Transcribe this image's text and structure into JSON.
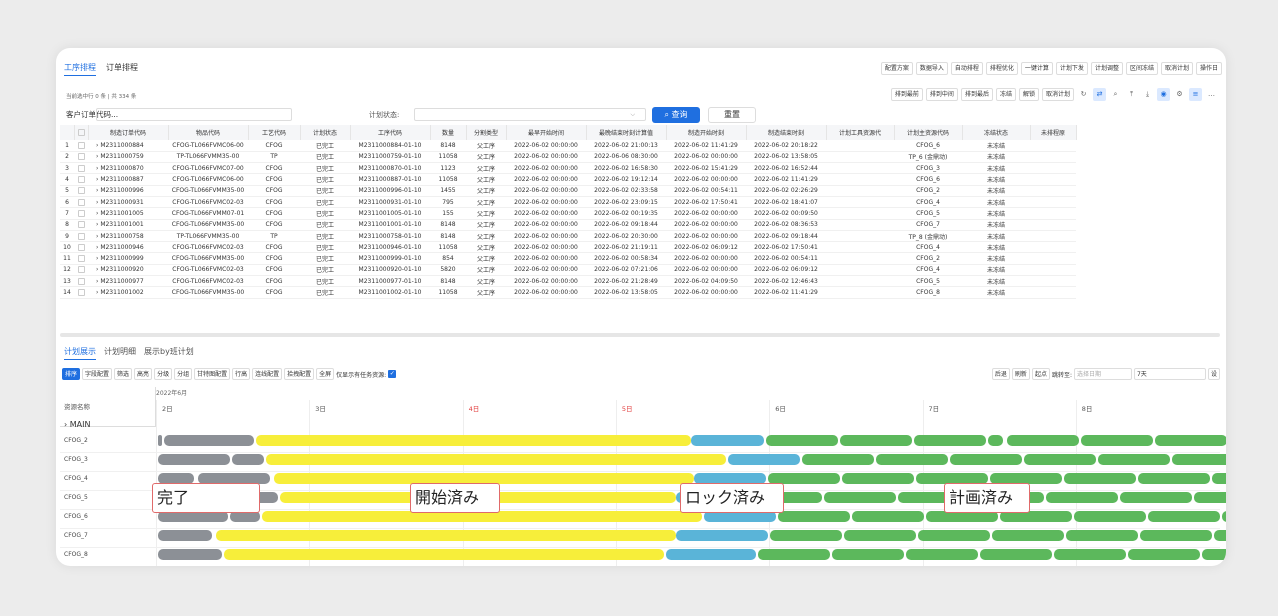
{
  "topTabs": [
    "工序排程",
    "订单排程"
  ],
  "toolbar1": [
    "配置方案",
    "数据导入",
    "自动排程",
    "排程优化",
    "一键计算",
    "计划下发",
    "计划调整",
    "区间冻结",
    "取消计划",
    "操作日"
  ],
  "toolbar2": [
    "排到最前",
    "排到中间",
    "排到最后",
    "冻结",
    "解锁",
    "取消计划"
  ],
  "selInfo": "当前选中行 0 条 | 共 334 条",
  "filter": {
    "customer_placeholder": "客户订单代码...",
    "status_label": "计划状态:",
    "query": "查询",
    "reset": "重置"
  },
  "columns": [
    "",
    "",
    "制造订单代码",
    "物品代码",
    "工艺代码",
    "计划状态",
    "工序代码",
    "数量",
    "分割类型",
    "最早开始时间",
    "最晚结束时刻计算值",
    "制造开始时刻",
    "制造结束时刻",
    "计划工具资源代",
    "计划主资源代码",
    "冻结状态",
    "未排程原"
  ],
  "rows": [
    [
      "1",
      "M2311000884",
      "CFOG-TL066FVMC06-00",
      "CFOG",
      "已完工",
      "M2311000884-01-10",
      "8148",
      "父工序",
      "2022-06-02 00:00:00",
      "2022-06-02 21:00:13",
      "2022-06-02 11:41:29",
      "2022-06-02 20:18:22",
      "",
      "CFOG_6",
      "未冻结"
    ],
    [
      "2",
      "M2311000759",
      "TP-TL066FVMM35-00",
      "TP",
      "已完工",
      "M2311000759-01-10",
      "11058",
      "父工序",
      "2022-06-02 00:00:00",
      "2022-06-06 08:30:00",
      "2022-06-02 00:00:00",
      "2022-06-02 13:58:05",
      "",
      "TP_6 (金鼎动)",
      "未冻结"
    ],
    [
      "3",
      "M2311000870",
      "CFOG-TL066FVMC07-00",
      "CFOG",
      "已完工",
      "M2311000870-01-10",
      "1123",
      "父工序",
      "2022-06-02 00:00:00",
      "2022-06-02 16:58:30",
      "2022-06-02 15:41:29",
      "2022-06-02 16:52:44",
      "",
      "CFOG_3",
      "未冻结"
    ],
    [
      "4",
      "M2311000887",
      "CFOG-TL066FVMC06-00",
      "CFOG",
      "已完工",
      "M2311000887-01-10",
      "11058",
      "父工序",
      "2022-06-02 00:00:00",
      "2022-06-02 19:12:14",
      "2022-06-02 00:00:00",
      "2022-06-02 11:41:29",
      "",
      "CFOG_6",
      "未冻结"
    ],
    [
      "5",
      "M2311000996",
      "CFOG-TL066FVMM35-00",
      "CFOG",
      "已完工",
      "M2311000996-01-10",
      "1455",
      "父工序",
      "2022-06-02 00:00:00",
      "2022-06-02 02:33:58",
      "2022-06-02 00:54:11",
      "2022-06-02 02:26:29",
      "",
      "CFOG_2",
      "未冻结"
    ],
    [
      "6",
      "M2311000931",
      "CFOG-TL066FVMC02-03",
      "CFOG",
      "已完工",
      "M2311000931-01-10",
      "795",
      "父工序",
      "2022-06-02 00:00:00",
      "2022-06-02 23:09:15",
      "2022-06-02 17:50:41",
      "2022-06-02 18:41:07",
      "",
      "CFOG_4",
      "未冻结"
    ],
    [
      "7",
      "M2311001005",
      "CFOG-TL066FVMM07-01",
      "CFOG",
      "已完工",
      "M2311001005-01-10",
      "155",
      "父工序",
      "2022-06-02 00:00:00",
      "2022-06-02 00:19:35",
      "2022-06-02 00:00:00",
      "2022-06-02 00:09:50",
      "",
      "CFOG_5",
      "未冻结"
    ],
    [
      "8",
      "M2311001001",
      "CFOG-TL066FVMM35-00",
      "CFOG",
      "已完工",
      "M2311001001-01-10",
      "8148",
      "父工序",
      "2022-06-02 00:00:00",
      "2022-06-02 09:18:44",
      "2022-06-02 00:00:00",
      "2022-06-02 08:36:53",
      "",
      "CFOG_7",
      "未冻结"
    ],
    [
      "9",
      "M2311000758",
      "TP-TL066FVMM35-00",
      "TP",
      "已完工",
      "M2311000758-01-10",
      "8148",
      "父工序",
      "2022-06-02 00:00:00",
      "2022-06-02 20:30:00",
      "2022-06-02 00:00:00",
      "2022-06-02 09:18:44",
      "",
      "TP_8 (金鼎动)",
      "未冻结"
    ],
    [
      "10",
      "M2311000946",
      "CFOG-TL066FVMC02-03",
      "CFOG",
      "已完工",
      "M2311000946-01-10",
      "11058",
      "父工序",
      "2022-06-02 00:00:00",
      "2022-06-02 21:19:11",
      "2022-06-02 06:09:12",
      "2022-06-02 17:50:41",
      "",
      "CFOG_4",
      "未冻结"
    ],
    [
      "11",
      "M2311000999",
      "CFOG-TL066FVMM35-00",
      "CFOG",
      "已完工",
      "M2311000999-01-10",
      "854",
      "父工序",
      "2022-06-02 00:00:00",
      "2022-06-02 00:58:34",
      "2022-06-02 00:00:00",
      "2022-06-02 00:54:11",
      "",
      "CFOG_2",
      "未冻结"
    ],
    [
      "12",
      "M2311000920",
      "CFOG-TL066FVMC02-03",
      "CFOG",
      "已完工",
      "M2311000920-01-10",
      "5820",
      "父工序",
      "2022-06-02 00:00:00",
      "2022-06-02 07:21:06",
      "2022-06-02 00:00:00",
      "2022-06-02 06:09:12",
      "",
      "CFOG_4",
      "未冻结"
    ],
    [
      "13",
      "M2311000977",
      "CFOG-TL066FVMC02-03",
      "CFOG",
      "已完工",
      "M2311000977-01-10",
      "8148",
      "父工序",
      "2022-06-02 00:00:00",
      "2022-06-02 21:28:49",
      "2022-06-02 04:09:50",
      "2022-06-02 12:46:43",
      "",
      "CFOG_5",
      "未冻结"
    ],
    [
      "14",
      "M2311001002",
      "CFOG-TL066FVMM35-00",
      "CFOG",
      "已完工",
      "M2311001002-01-10",
      "11058",
      "父工序",
      "2022-06-02 00:00:00",
      "2022-06-02 13:58:05",
      "2022-06-02 00:00:00",
      "2022-06-02 11:41:29",
      "",
      "CFOG_8",
      "未冻结"
    ]
  ],
  "bottomTabs": [
    "计划展示",
    "计划明细",
    "展示by班计划"
  ],
  "ganttToolbar": [
    "排序",
    "字段配置",
    "筛选",
    "高亮",
    "分级",
    "分组",
    "甘特图配置",
    "行高",
    "连线配置",
    "拾拽配置",
    "全屏"
  ],
  "onlyTasks": "仅显示有任务资源:",
  "ganttRight": [
    "后退",
    "刷新",
    "起点",
    "跳转至:",
    "选择日期",
    "7天",
    "设"
  ],
  "resourceHeader": "资源名称",
  "yearMonth": "2022年6月",
  "days": [
    {
      "label": "2日",
      "red": false
    },
    {
      "label": "3日",
      "red": false
    },
    {
      "label": "4日",
      "red": true
    },
    {
      "label": "5日",
      "red": true
    },
    {
      "label": "6日",
      "red": false
    },
    {
      "label": "7日",
      "red": false
    },
    {
      "label": "8日",
      "red": false
    }
  ],
  "mainGroup": "MAIN",
  "resources": [
    "CFOG_2",
    "CFOG_3",
    "CFOG_4",
    "CFOG_5",
    "CFOG_6",
    "CFOG_7",
    "CFOG_8"
  ],
  "callouts": [
    "完了",
    "開始済み",
    "ロック済み",
    "計画済み"
  ],
  "colors": {
    "done": "#8c9096",
    "started": "#f7ee3a",
    "locked": "#5ab4d8",
    "planned": "#5cb85c"
  }
}
